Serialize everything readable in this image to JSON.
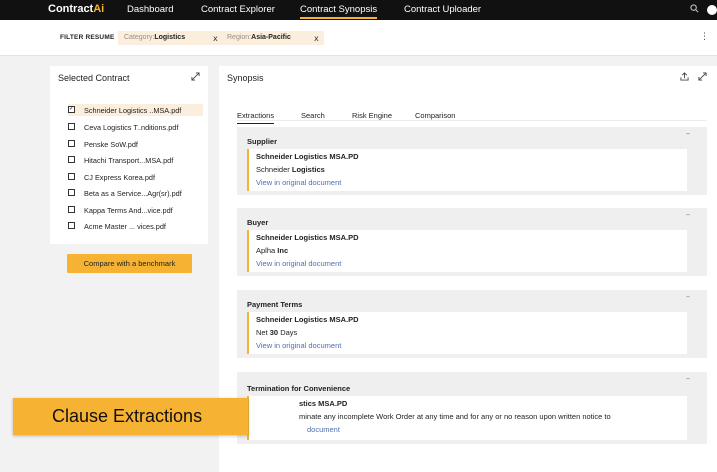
{
  "nav": {
    "logo_main": "Contract",
    "logo_accent": "Ai",
    "items": [
      "Dashboard",
      "Contract Explorer",
      "Contract Synopsis",
      "Contract Uploader"
    ],
    "active_index": 2
  },
  "filter": {
    "label": "FILTER RESUME",
    "chips": [
      {
        "key": "Category:",
        "value": "Logistics"
      },
      {
        "key": "Region:",
        "value": "Asia-Pacific"
      }
    ],
    "remove_glyph": "x",
    "menu_glyph": "⋮"
  },
  "selected_panel": {
    "title": "Selected Contract",
    "files": [
      {
        "name": "Schneider Logistics ..MSA.pdf",
        "checked": true
      },
      {
        "name": "Ceva Logistics T..nditions.pdf",
        "checked": false
      },
      {
        "name": "Penske SoW.pdf",
        "checked": false
      },
      {
        "name": "Hitachi Transport...MSA.pdf",
        "checked": false
      },
      {
        "name": "CJ Express Korea.pdf",
        "checked": false
      },
      {
        "name": "Beta as a Service...Agr(sr).pdf",
        "checked": false
      },
      {
        "name": "Kappa Terms And...vice.pdf",
        "checked": false
      },
      {
        "name": "Acme Master ... vices.pdf",
        "checked": false
      }
    ],
    "check_glyph": "✓",
    "benchmark_button": "Compare with a benchmark"
  },
  "synopsis": {
    "title": "Synopsis",
    "tabs": [
      "Extractions",
      "Search",
      "Risk Engine",
      "Comparison"
    ],
    "active_tab": 0,
    "cards": [
      {
        "title": "Supplier",
        "source": "Schneider Logistics MSA.PD",
        "text_plain": "Schneider ",
        "text_bold": "Logistics",
        "text_after": "",
        "link": "View in original document"
      },
      {
        "title": "Buyer",
        "source": "Schneider Logistics MSA.PD",
        "text_plain": "Aplha ",
        "text_bold": "Inc",
        "text_after": "",
        "link": "View in original document"
      },
      {
        "title": "Payment Terms",
        "source": "Schneider Logistics MSA.PD",
        "text_plain": "Net ",
        "text_bold": "30",
        "text_after": " Days",
        "link": "View in original document"
      },
      {
        "title": "Termination for Convenience",
        "source": "stics MSA.PD",
        "text_plain": "minate any incomplete Work Order at any time and for any or no reason upon written notice to",
        "text_bold": "",
        "text_after": "",
        "link": "document"
      }
    ],
    "minimize_glyph": "–"
  },
  "icons": {
    "expand": "expand-icon",
    "share": "share-icon",
    "search": "search-icon",
    "user": "user-dot-icon"
  },
  "overlay": {
    "label": "Clause Extractions"
  },
  "colors": {
    "accent": "#f6b233",
    "nav_bg": "#111111",
    "chip_bg": "#fbeedd",
    "link": "#4f6fb0",
    "card_bg": "#efefef"
  }
}
